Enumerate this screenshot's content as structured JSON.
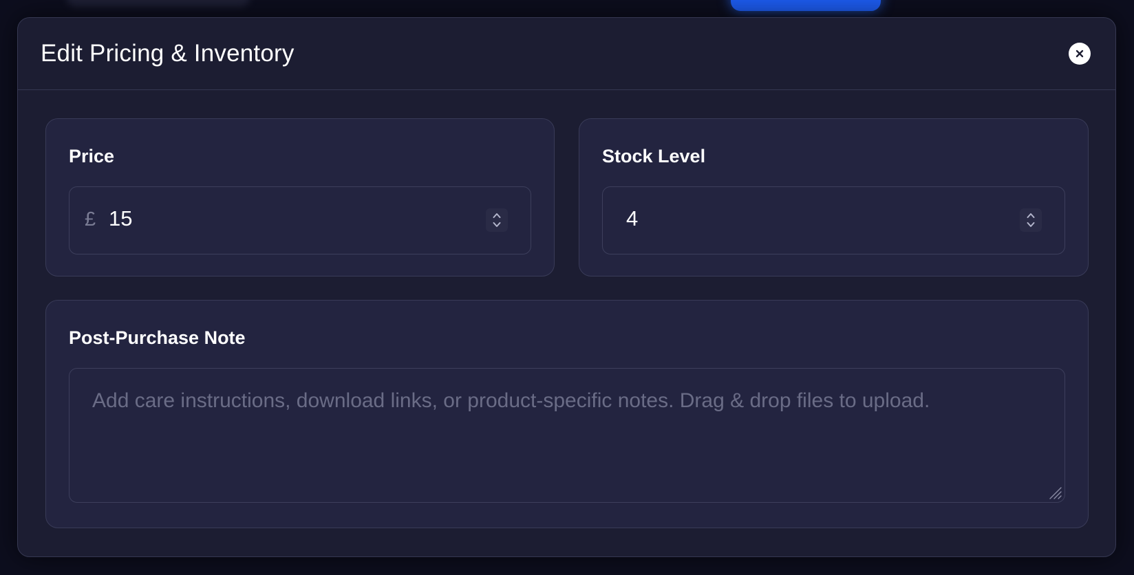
{
  "modal": {
    "title": "Edit Pricing & Inventory",
    "close_icon": "close-icon"
  },
  "price": {
    "label": "Price",
    "currency_symbol": "£",
    "value": "15",
    "stepper_icon": "chevron-up-down-icon"
  },
  "stock": {
    "label": "Stock Level",
    "value": "4",
    "stepper_icon": "chevron-up-down-icon"
  },
  "note": {
    "label": "Post-Purchase Note",
    "placeholder": "Add care instructions, download links, or product-specific notes. Drag & drop files to upload.",
    "value": "",
    "resize_icon": "resize-handle-icon"
  },
  "colors": {
    "modal_bg": "#1c1d32",
    "card_bg": "#232440",
    "border": "#393b58",
    "accent_button": "#1d5cf0",
    "text": "#ffffff",
    "muted_text": "#6a6c86"
  }
}
